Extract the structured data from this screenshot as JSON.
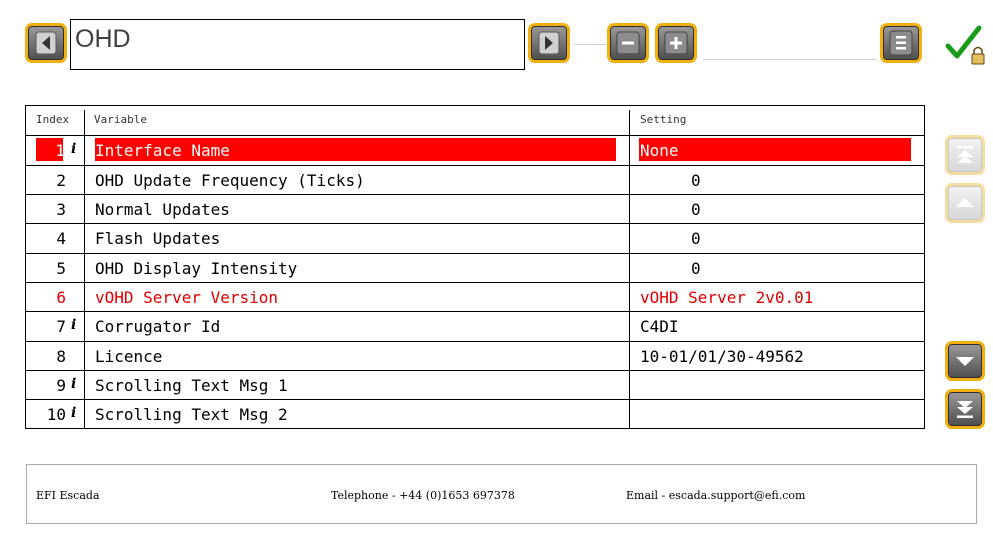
{
  "header": {
    "title": "OHD",
    "confirm_icon": "checkmark-lock-icon"
  },
  "table": {
    "headers": [
      "Index",
      "Variable",
      "Setting"
    ],
    "rows": [
      {
        "index": "1",
        "info": "i",
        "variable": "Interface Name",
        "setting": "None"
      },
      {
        "index": "2",
        "info": "",
        "variable": "OHD Update Frequency (Ticks)",
        "setting": "0"
      },
      {
        "index": "3",
        "info": "",
        "variable": "Normal Updates",
        "setting": "0"
      },
      {
        "index": "4",
        "info": "",
        "variable": "Flash Updates",
        "setting": "0"
      },
      {
        "index": "5",
        "info": "",
        "variable": "OHD Display Intensity",
        "setting": "0"
      },
      {
        "index": "6",
        "info": "",
        "variable": "vOHD Server Version",
        "setting": "vOHD Server 2v0.01"
      },
      {
        "index": "7",
        "info": "i",
        "variable": "Corrugator Id",
        "setting": "C4DI"
      },
      {
        "index": "8",
        "info": "",
        "variable": "Licence",
        "setting": "10-01/01/30-49562"
      },
      {
        "index": "9",
        "info": "i",
        "variable": "Scrolling Text Msg 1",
        "setting": ""
      },
      {
        "index": "10",
        "info": "i",
        "variable": "Scrolling Text Msg 2",
        "setting": ""
      }
    ]
  },
  "footer": {
    "company": "EFI Escada",
    "telephone": "Telephone - +44 (0)1653 697378",
    "email": "Email - escada.support@efi.com"
  },
  "colors": {
    "accent": "#f0b010",
    "selection": "#ff0000",
    "readonly_text": "#e00000",
    "confirm": "#1a9a1a"
  }
}
